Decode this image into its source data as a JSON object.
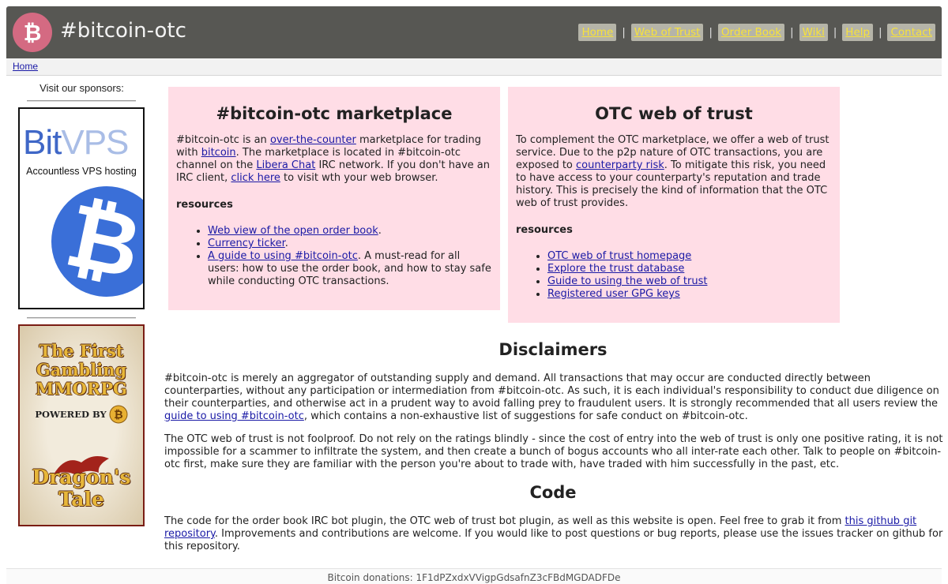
{
  "header": {
    "site_title": "#bitcoin-otc",
    "logo_icon": "bitcoin-icon",
    "nav": [
      {
        "label": "Home"
      },
      {
        "label": "Web of Trust"
      },
      {
        "label": "Order Book"
      },
      {
        "label": "Wiki"
      },
      {
        "label": "Help"
      },
      {
        "label": "Contact"
      }
    ],
    "separator": "|"
  },
  "breadcrumb": {
    "home": "Home"
  },
  "sidebar": {
    "sponsor_label": "Visit our sponsors:",
    "ad1": {
      "brand_a": "Bit",
      "brand_b": "VPS",
      "tagline": "Accountless VPS hosting"
    },
    "ad2": {
      "title": "The First Gambling MMORPG",
      "powered_by": "POWERED BY",
      "name": "Dragon's Tale"
    }
  },
  "marketplace": {
    "title": "#bitcoin-otc marketplace",
    "intro_1": "#bitcoin-otc is an ",
    "link_otc": "over-the-counter",
    "intro_2": " marketplace for trading with ",
    "link_bitcoin": "bitcoin",
    "intro_3": ". The marketplace is located in #bitcoin-otc channel on the ",
    "link_libera": "Libera Chat",
    "intro_4": " IRC network. If you don't have an IRC client, ",
    "link_click": "click here",
    "intro_5": " to visit wth your web browser.",
    "resources_heading": "resources",
    "res1_link": "Web view of the open order book",
    "res1_tail": ".",
    "res2_link": "Currency ticker",
    "res2_tail": ".",
    "res3_link": "A guide to using #bitcoin-otc",
    "res3_tail": ". A must-read for all users: how to use the order book, and how to stay safe while conducting OTC transactions."
  },
  "trust": {
    "title": "OTC web of trust",
    "intro_1": "To complement the OTC marketplace, we offer a web of trust service. Due to the p2p nature of OTC transactions, you are exposed to ",
    "link_risk": "counterparty risk",
    "intro_2": ". To mitigate this risk, you need to have access to your counterparty's reputation and trade history. This is precisely the kind of information that the OTC web of trust provides.",
    "resources_heading": "resources",
    "links": [
      "OTC web of trust homepage",
      "Explore the trust database",
      "Guide to using the web of trust",
      "Registered user GPG keys"
    ]
  },
  "disclaimers": {
    "title": "Disclaimers",
    "p1_a": "#bitcoin-otc is merely an aggregator of outstanding supply and demand. All transactions that may occur are conducted directly between counterparties, without any participation or intermediation from #bitcoin-otc. As such, it is each individual's responsibility to conduct due diligence on their counterparties, and otherwise act in a prudent way to avoid falling prey to fraudulent users. It is strongly recommended that all users review the ",
    "p1_link": "guide to using #bitcoin-otc",
    "p1_b": ", which contains a non-exhaustive list of suggestions for safe conduct on #bitcoin-otc.",
    "p2": "The OTC web of trust is not foolproof. Do not rely on the ratings blindly - since the cost of entry into the web of trust is only one positive rating, it is not impossible for a scammer to infiltrate the system, and then create a bunch of bogus accounts who all inter-rate each other. Talk to people on #bitcoin-otc first, make sure they are familiar with the person you're about to trade with, have traded with him successfully in the past, etc."
  },
  "code": {
    "title": "Code",
    "p_a": "The code for the order book IRC bot plugin, the OTC web of trust bot plugin, as well as this website is open. Feel free to grab it from ",
    "p_link": "this github git repository",
    "p_b": ". Improvements and contributions are welcome. If you would like to post questions or bug reports, please use the issues tracker on github for this repository."
  },
  "footer": {
    "donations": "Bitcoin donations: 1F1dPZxdxVVigpGdsafnZ3cFBdMGDADFDe"
  },
  "colors": {
    "header_bg": "#575753",
    "nav_link": "#f7e23b",
    "panel_bg": "#ffdde6",
    "logo_bg": "#d46a82"
  }
}
